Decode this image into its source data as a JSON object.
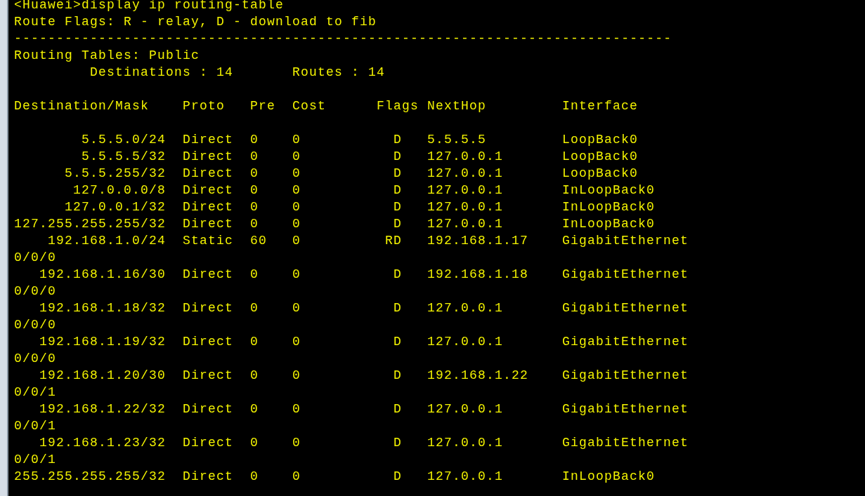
{
  "terminal": {
    "command_line": "<Huawei>display ip routing-table",
    "flags_legend": "Route Flags: R - relay, D - download to fib",
    "separator": "------------------------------------------------------------------------------",
    "table_title": "Routing Tables: Public",
    "summary": [
      {
        "text": "Destinations : 14"
      },
      {
        "text": "Routes : 14"
      }
    ],
    "columns": [
      "Destination/Mask",
      "Proto",
      "Pre",
      "Cost",
      "Flags",
      "NextHop",
      "Interface"
    ],
    "rows": [
      {
        "destination": "5.5.5.0/24",
        "proto": "Direct",
        "pre": "0",
        "cost": "0",
        "flags": "D",
        "next_hop": "5.5.5.5",
        "interface": "LoopBack0"
      },
      {
        "destination": "5.5.5.5/32",
        "proto": "Direct",
        "pre": "0",
        "cost": "0",
        "flags": "D",
        "next_hop": "127.0.0.1",
        "interface": "LoopBack0"
      },
      {
        "destination": "5.5.5.255/32",
        "proto": "Direct",
        "pre": "0",
        "cost": "0",
        "flags": "D",
        "next_hop": "127.0.0.1",
        "interface": "LoopBack0"
      },
      {
        "destination": "127.0.0.0/8",
        "proto": "Direct",
        "pre": "0",
        "cost": "0",
        "flags": "D",
        "next_hop": "127.0.0.1",
        "interface": "InLoopBack0"
      },
      {
        "destination": "127.0.0.1/32",
        "proto": "Direct",
        "pre": "0",
        "cost": "0",
        "flags": "D",
        "next_hop": "127.0.0.1",
        "interface": "InLoopBack0"
      },
      {
        "destination": "127.255.255.255/32",
        "proto": "Direct",
        "pre": "0",
        "cost": "0",
        "flags": "D",
        "next_hop": "127.0.0.1",
        "interface": "InLoopBack0"
      },
      {
        "destination": "192.168.1.0/24",
        "proto": "Static",
        "pre": "60",
        "cost": "0",
        "flags": "RD",
        "next_hop": "192.168.1.17",
        "interface": "GigabitEthernet",
        "interface_wrap": "0/0/0"
      },
      {
        "destination": "192.168.1.16/30",
        "proto": "Direct",
        "pre": "0",
        "cost": "0",
        "flags": "D",
        "next_hop": "192.168.1.18",
        "interface": "GigabitEthernet",
        "interface_wrap": "0/0/0"
      },
      {
        "destination": "192.168.1.18/32",
        "proto": "Direct",
        "pre": "0",
        "cost": "0",
        "flags": "D",
        "next_hop": "127.0.0.1",
        "interface": "GigabitEthernet",
        "interface_wrap": "0/0/0"
      },
      {
        "destination": "192.168.1.19/32",
        "proto": "Direct",
        "pre": "0",
        "cost": "0",
        "flags": "D",
        "next_hop": "127.0.0.1",
        "interface": "GigabitEthernet",
        "interface_wrap": "0/0/0"
      },
      {
        "destination": "192.168.1.20/30",
        "proto": "Direct",
        "pre": "0",
        "cost": "0",
        "flags": "D",
        "next_hop": "192.168.1.22",
        "interface": "GigabitEthernet",
        "interface_wrap": "0/0/1"
      },
      {
        "destination": "192.168.1.22/32",
        "proto": "Direct",
        "pre": "0",
        "cost": "0",
        "flags": "D",
        "next_hop": "127.0.0.1",
        "interface": "GigabitEthernet",
        "interface_wrap": "0/0/1"
      },
      {
        "destination": "192.168.1.23/32",
        "proto": "Direct",
        "pre": "0",
        "cost": "0",
        "flags": "D",
        "next_hop": "127.0.0.1",
        "interface": "GigabitEthernet",
        "interface_wrap": "0/0/1"
      },
      {
        "destination": "255.255.255.255/32",
        "proto": "Direct",
        "pre": "0",
        "cost": "0",
        "flags": "D",
        "next_hop": "127.0.0.1",
        "interface": "InLoopBack0"
      }
    ]
  }
}
